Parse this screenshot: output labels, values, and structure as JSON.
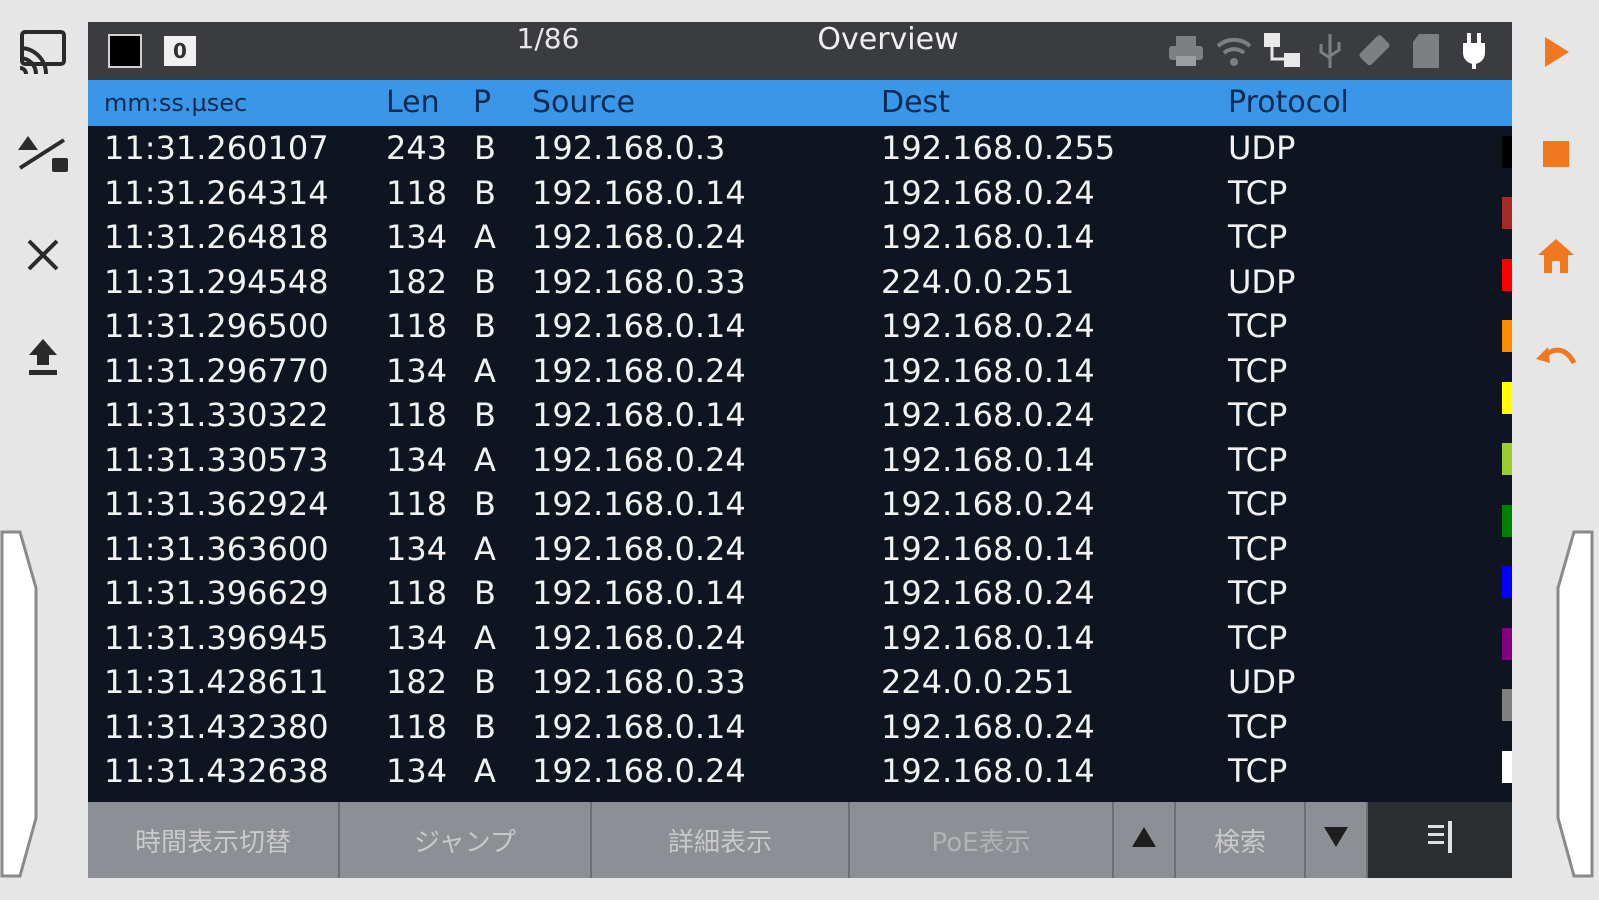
{
  "header": {
    "page_indicator": "1/86",
    "title": "Overview",
    "zero_box": "0"
  },
  "columns": {
    "time": "mm:ss.µsec",
    "len": "Len",
    "p": "P",
    "source": "Source",
    "dest": "Dest",
    "protocol": "Protocol"
  },
  "rows": [
    {
      "time": "11:31.260107",
      "len": "243",
      "p": "B",
      "source": "192.168.0.3",
      "dest": "192.168.0.255",
      "protocol": "UDP"
    },
    {
      "time": "11:31.264314",
      "len": "118",
      "p": "B",
      "source": "192.168.0.14",
      "dest": "192.168.0.24",
      "protocol": "TCP"
    },
    {
      "time": "11:31.264818",
      "len": "134",
      "p": "A",
      "source": "192.168.0.24",
      "dest": "192.168.0.14",
      "protocol": "TCP"
    },
    {
      "time": "11:31.294548",
      "len": "182",
      "p": "B",
      "source": "192.168.0.33",
      "dest": "224.0.0.251",
      "protocol": "UDP"
    },
    {
      "time": "11:31.296500",
      "len": "118",
      "p": "B",
      "source": "192.168.0.14",
      "dest": "192.168.0.24",
      "protocol": "TCP"
    },
    {
      "time": "11:31.296770",
      "len": "134",
      "p": "A",
      "source": "192.168.0.24",
      "dest": "192.168.0.14",
      "protocol": "TCP"
    },
    {
      "time": "11:31.330322",
      "len": "118",
      "p": "B",
      "source": "192.168.0.14",
      "dest": "192.168.0.24",
      "protocol": "TCP"
    },
    {
      "time": "11:31.330573",
      "len": "134",
      "p": "A",
      "source": "192.168.0.24",
      "dest": "192.168.0.14",
      "protocol": "TCP"
    },
    {
      "time": "11:31.362924",
      "len": "118",
      "p": "B",
      "source": "192.168.0.14",
      "dest": "192.168.0.24",
      "protocol": "TCP"
    },
    {
      "time": "11:31.363600",
      "len": "134",
      "p": "A",
      "source": "192.168.0.24",
      "dest": "192.168.0.14",
      "protocol": "TCP"
    },
    {
      "time": "11:31.396629",
      "len": "118",
      "p": "B",
      "source": "192.168.0.14",
      "dest": "192.168.0.24",
      "protocol": "TCP"
    },
    {
      "time": "11:31.396945",
      "len": "134",
      "p": "A",
      "source": "192.168.0.24",
      "dest": "192.168.0.14",
      "protocol": "TCP"
    },
    {
      "time": "11:31.428611",
      "len": "182",
      "p": "B",
      "source": "192.168.0.33",
      "dest": "224.0.0.251",
      "protocol": "UDP"
    },
    {
      "time": "11:31.432380",
      "len": "118",
      "p": "B",
      "source": "192.168.0.14",
      "dest": "192.168.0.24",
      "protocol": "TCP"
    },
    {
      "time": "11:31.432638",
      "len": "134",
      "p": "A",
      "source": "192.168.0.24",
      "dest": "192.168.0.14",
      "protocol": "TCP"
    }
  ],
  "color_strip": [
    "#000000",
    "#a52a2a",
    "#ff0000",
    "#ff8c00",
    "#ffff00",
    "#9acd32",
    "#008000",
    "#0000ff",
    "#800080",
    "#808080",
    "#ffffff"
  ],
  "toolbar": {
    "time_toggle": "時間表示切替",
    "jump": "ジャンプ",
    "details": "詳細表示",
    "poe": "PoE表示",
    "search": "検索"
  },
  "icons": {
    "left": [
      "cast-icon",
      "capture-toggle-icon",
      "close-icon",
      "upload-icon"
    ],
    "right": [
      "play-icon",
      "stop-icon",
      "home-icon",
      "undo-icon"
    ],
    "status": [
      "printer-icon",
      "wifi-icon",
      "network-icon",
      "usb-icon",
      "eraser-icon",
      "sd-card-icon",
      "power-plug-icon"
    ]
  },
  "colors": {
    "panel_bg": "#0e1520",
    "header_bar": "#3a3c3f",
    "column_header": "#3a96e6",
    "accent_orange": "#f07820",
    "toolbar_button": "#8c8f93"
  }
}
